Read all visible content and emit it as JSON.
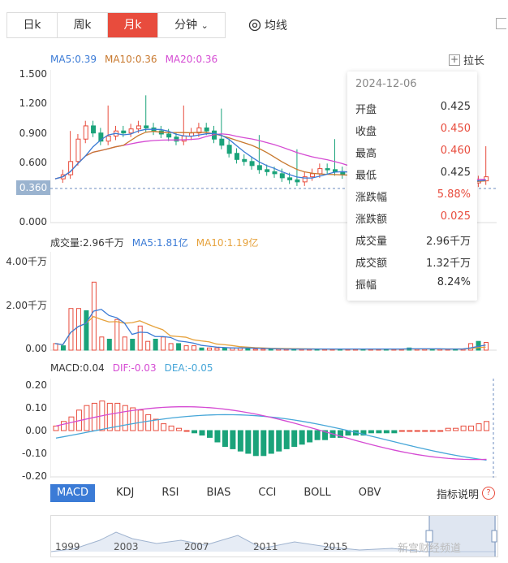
{
  "tabs": [
    {
      "label": "日k"
    },
    {
      "label": "周k"
    },
    {
      "label": "月k"
    },
    {
      "label": "分钟"
    }
  ],
  "avg_label": "均线",
  "zoom_label": "拉长",
  "ma_legend": {
    "ma5": "MA5:0.39",
    "ma10": "MA10:0.36",
    "ma20": "MA20:0.36"
  },
  "price_axis": [
    "1.500",
    "1.200",
    "0.900",
    "0.600",
    "0.000"
  ],
  "price_marker": "0.360",
  "volume_legend": {
    "title": "成交量:2.96千万",
    "ma5": "MA5:1.81亿",
    "ma10": "MA10:1.19亿"
  },
  "volume_axis": [
    "4.00千万",
    "2.00千万",
    "0.00"
  ],
  "macd_legend": {
    "macd": "MACD:0.04",
    "dif": "DIF:-0.03",
    "dea": "DEA:-0.05"
  },
  "macd_axis": [
    "0.20",
    "0.10",
    "0.00",
    "-0.10",
    "-0.20"
  ],
  "tooltip": {
    "date": "2024-12-06",
    "rows": [
      {
        "label": "开盘",
        "value": "0.425",
        "color": "#333333"
      },
      {
        "label": "收盘",
        "value": "0.450",
        "color": "#e84c3d"
      },
      {
        "label": "最高",
        "value": "0.460",
        "color": "#e84c3d"
      },
      {
        "label": "最低",
        "value": "0.425",
        "color": "#333333"
      },
      {
        "label": "涨跌幅",
        "value": "5.88%",
        "color": "#e84c3d"
      },
      {
        "label": "涨跌额",
        "value": "0.025",
        "color": "#e84c3d"
      },
      {
        "label": "成交量",
        "value": "2.96千万",
        "color": "#333333"
      },
      {
        "label": "成交额",
        "value": "1.32千万",
        "color": "#333333"
      },
      {
        "label": "振幅",
        "value": "8.24%",
        "color": "#333333"
      }
    ]
  },
  "indicator_tabs": [
    "MACD",
    "KDJ",
    "RSI",
    "BIAS",
    "CCI",
    "BOLL",
    "OBV"
  ],
  "help_label": "指标说明",
  "timeline_years": [
    "1999",
    "2003",
    "2007",
    "2011",
    "2015"
  ],
  "watermark": "新宫财经频道",
  "colors": {
    "up": "#e84c3d",
    "down": "#1aa37a",
    "ma5": "#3b7bd6",
    "ma10": "#c8782d",
    "ma20": "#d54bd3",
    "macd_dif": "#d54bd3",
    "macd_dea": "#46a6d8",
    "active_tab": "#e84c3d",
    "indicator_active": "#3b7bd6"
  }
}
